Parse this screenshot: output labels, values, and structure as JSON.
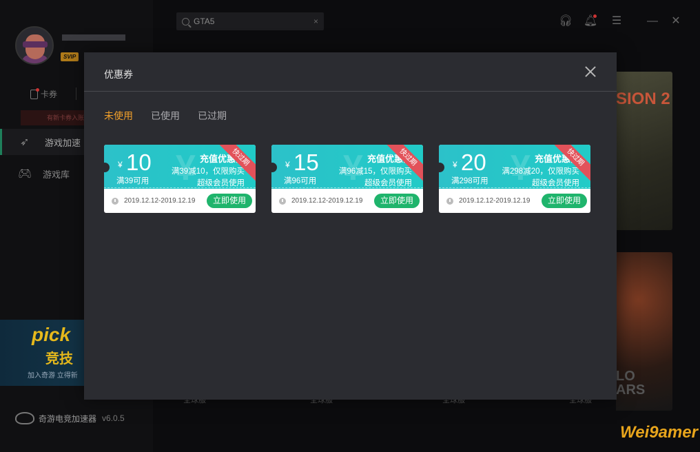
{
  "sidebar": {
    "badge": "SVIP",
    "card_tab": "卡券",
    "notice": "有新卡券入账",
    "nav": [
      {
        "label": "游戏加速"
      },
      {
        "label": "游戏库"
      }
    ],
    "promo": {
      "big": "pick",
      "mid": "竞技",
      "small": "加入奇游 立得新"
    },
    "brand": {
      "name": "奇游电竞加速器",
      "version": "v6.0.5"
    }
  },
  "topbar": {
    "search_value": "GTA5",
    "search_clear": "×"
  },
  "background": {
    "game_art_1": "SION 2",
    "game_art_2": "LO\nARS",
    "card_label": "全球服"
  },
  "modal": {
    "title": "优惠券",
    "tabs": [
      {
        "label": "未使用",
        "active": true
      },
      {
        "label": "已使用",
        "active": false
      },
      {
        "label": "已过期",
        "active": false
      }
    ],
    "coupons": [
      {
        "currency": "¥",
        "amount": "10",
        "threshold": "满39可用",
        "title": "充值优惠券",
        "desc": "满39减10，仅限购买",
        "type": "超级会员使用",
        "ribbon": "快过期",
        "validity": "2019.12.12-2019.12.19",
        "button": "立即使用"
      },
      {
        "currency": "¥",
        "amount": "15",
        "threshold": "满96可用",
        "title": "充值优惠券",
        "desc": "满96减15，仅限购买",
        "type": "超级会员使用",
        "ribbon": "快过期",
        "validity": "2019.12.12-2019.12.19",
        "button": "立即使用"
      },
      {
        "currency": "¥",
        "amount": "20",
        "threshold": "满298可用",
        "title": "充值优惠券",
        "desc": "满298减20，仅限购买",
        "type": "超级会员使用",
        "ribbon": "快过期",
        "validity": "2019.12.12-2019.12.19",
        "button": "立即使用"
      }
    ]
  },
  "watermark": "Wei9amer",
  "colors": {
    "accent_orange": "#f2a12a",
    "coupon_teal": "#2cc1c9",
    "button_green": "#1fb46c",
    "ribbon_red": "#e2525a",
    "modal_bg": "#2b2c31"
  },
  "icons": {
    "search": "search-icon",
    "headset": "headset-icon",
    "bell": "bell-icon",
    "list": "list-icon",
    "minimize": "minimize-icon",
    "close": "close-icon",
    "clock": "clock-icon"
  }
}
